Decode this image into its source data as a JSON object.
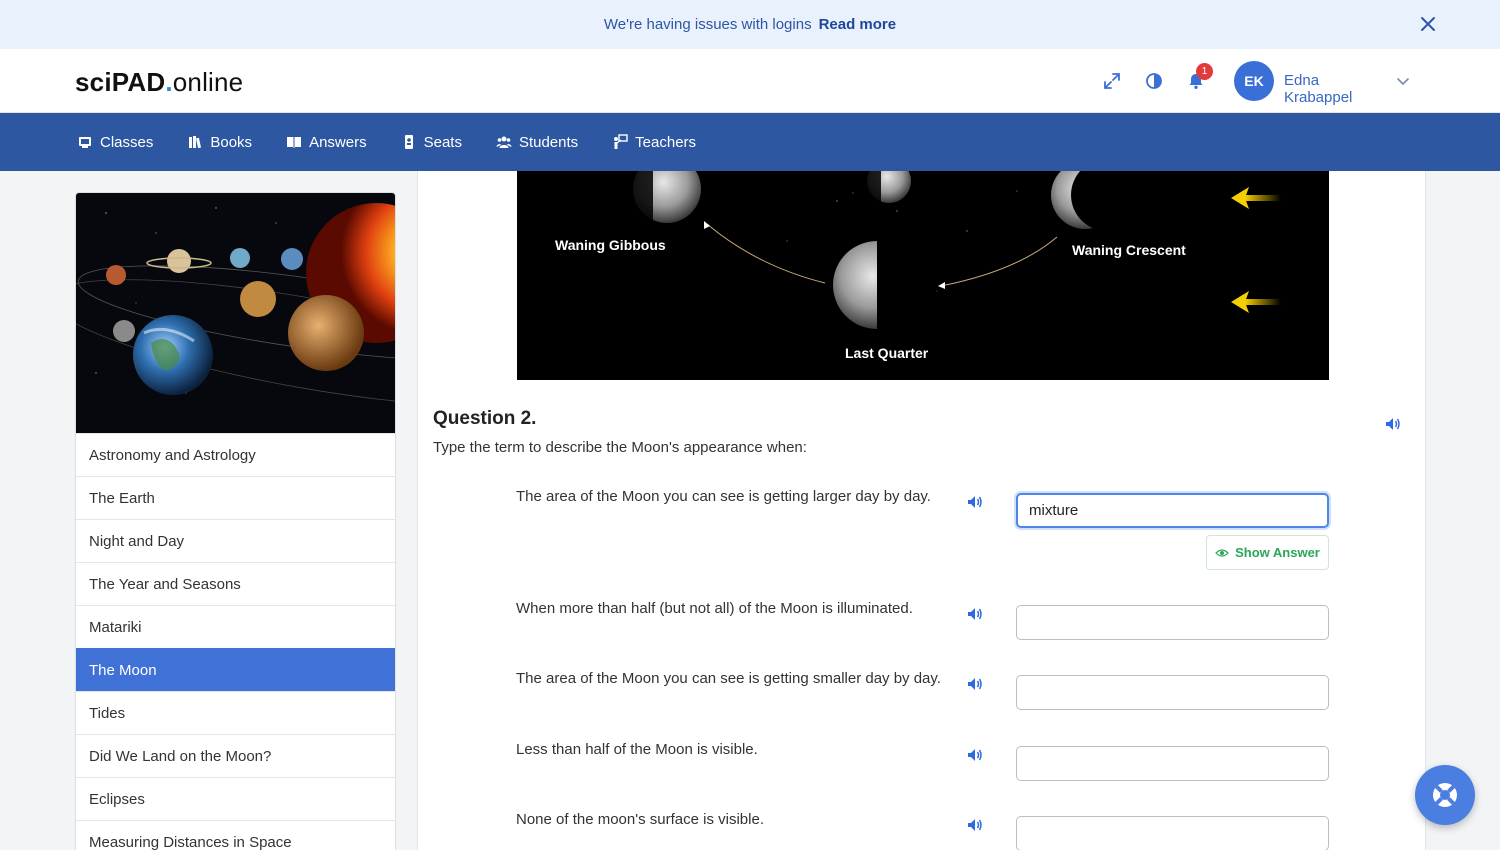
{
  "banner": {
    "message": "We're having issues with logins",
    "link": "Read more"
  },
  "header": {
    "logo_bold": "sciPAD",
    "logo_dot": ".",
    "logo_rest": "online",
    "notification_count": "1",
    "avatar_initials": "EK",
    "user_name": "Edna Krabappel"
  },
  "nav": {
    "items": [
      {
        "label": "Classes",
        "icon": "classes-icon"
      },
      {
        "label": "Books",
        "icon": "books-icon"
      },
      {
        "label": "Answers",
        "icon": "answers-icon"
      },
      {
        "label": "Seats",
        "icon": "seats-icon"
      },
      {
        "label": "Students",
        "icon": "students-icon"
      },
      {
        "label": "Teachers",
        "icon": "teachers-icon"
      }
    ]
  },
  "sidebar": {
    "items": [
      {
        "label": "Astronomy and Astrology"
      },
      {
        "label": "The Earth"
      },
      {
        "label": "Night and Day"
      },
      {
        "label": "The Year and Seasons"
      },
      {
        "label": "Matariki"
      },
      {
        "label": "The Moon",
        "active": true
      },
      {
        "label": "Tides"
      },
      {
        "label": "Did We Land on the Moon?"
      },
      {
        "label": "Eclipses"
      },
      {
        "label": "Measuring Distances in Space"
      }
    ]
  },
  "moon_image": {
    "labels": [
      "Waning Gibbous",
      "Waning Crescent",
      "Last Quarter"
    ]
  },
  "question": {
    "title": "Question 2.",
    "instruction": "Type the term to describe the Moon's appearance when:",
    "rows": [
      {
        "text": "The area of the Moon you can see is getting larger day by day.",
        "value": "mixture"
      },
      {
        "text": "When more than half (but not all) of the Moon is illuminated.",
        "value": ""
      },
      {
        "text": "The area of the Moon you can see is getting smaller day by day.",
        "value": ""
      },
      {
        "text": "Less than half of the Moon is visible.",
        "value": ""
      },
      {
        "text": "None of the moon's surface is visible.",
        "value": ""
      }
    ],
    "show_answer_label": "Show Answer"
  },
  "colors": {
    "nav_bg": "#2d57a0",
    "active_item": "#3f71d6",
    "banner_bg": "#e8f1fc",
    "accent": "#3a6fd8",
    "success": "#2aa65a"
  }
}
